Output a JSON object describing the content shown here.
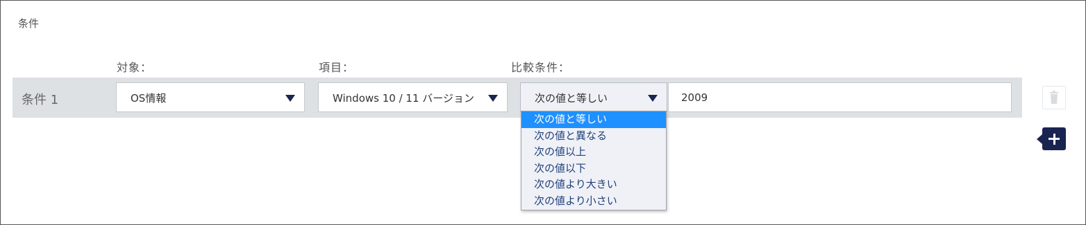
{
  "section": {
    "title": "条件"
  },
  "columns": {
    "target_label": "対象：",
    "item_label": "項目：",
    "compare_label": "比較条件："
  },
  "condition": {
    "label": "条件 1",
    "target_value": "OS情報",
    "item_value": "Windows 10 / 11 バージョン",
    "compare_value": "次の値と等しい",
    "input_value": "2009"
  },
  "compare_options": [
    "次の値と等しい",
    "次の値と異なる",
    "次の値以上",
    "次の値以下",
    "次の値より大きい",
    "次の値より小さい"
  ],
  "icons": {
    "delete": "trash-icon",
    "add": "plus-icon",
    "dropdown": "caret-down-icon"
  },
  "colors": {
    "row_band": "#dde1e4",
    "accent_navy": "#1a2450",
    "selected_option": "#1e90ff",
    "option_text": "#1e3f7a"
  }
}
